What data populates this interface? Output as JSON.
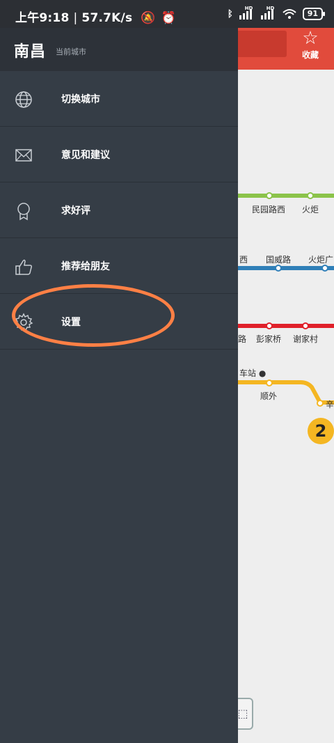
{
  "status_bar": {
    "time": "上午9:18",
    "speed": "57.7K/s",
    "battery": "91",
    "signal_tag": "HD"
  },
  "map": {
    "favorite_label": "收藏",
    "line_badge": "2",
    "stations": {
      "minyuanlu_xi": "民园路西",
      "huoju": "火炬",
      "xi": "西",
      "guoweilu": "国威路",
      "huojuguang": "火炬广",
      "lu": "路",
      "pengjiaqiao": "彭家桥",
      "xiejiacun": "谢家村",
      "zhan": "车站",
      "shunwai": "顺外",
      "xin": "辛"
    },
    "colors": {
      "line_green": "#8bc34a",
      "line_blue": "#2f7fb8",
      "line_red": "#e0202a",
      "line_yellow": "#f4b622",
      "header_red": "#e14b3c"
    }
  },
  "drawer": {
    "city_name": "南昌",
    "city_subtitle": "当前城市",
    "items": [
      {
        "label": "切换城市",
        "icon": "globe-icon"
      },
      {
        "label": "意见和建议",
        "icon": "mail-icon"
      },
      {
        "label": "求好评",
        "icon": "award-icon"
      },
      {
        "label": "推荐给朋友",
        "icon": "thumbs-up-icon"
      },
      {
        "label": "设置",
        "icon": "gear-icon"
      }
    ],
    "colors": {
      "background": "#353d46",
      "header": "#2d3239",
      "highlight": "#ff8045"
    }
  }
}
